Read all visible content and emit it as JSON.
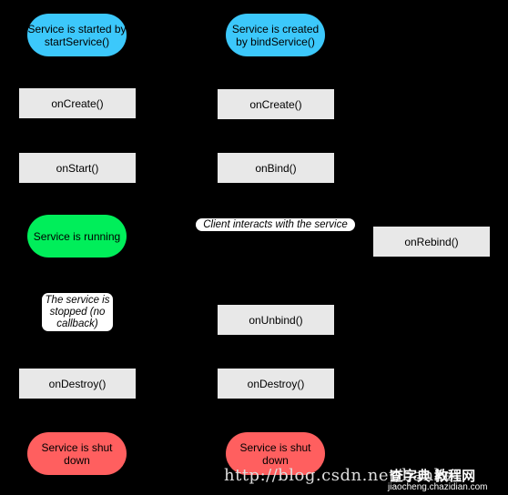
{
  "colors": {
    "start": "#3cc8fb",
    "running": "#00ee5a",
    "shutdown": "#ff5f5f",
    "box": "#e8e8e8"
  },
  "left": {
    "start": "Service is started by startService()",
    "on_create": "onCreate()",
    "on_start": "onStart()",
    "running": "Service is running",
    "stopped": "The service is stopped (no callback)",
    "on_destroy": "onDestroy()",
    "shutdown": "Service is shut down"
  },
  "right": {
    "start": "Service is created by bindService()",
    "on_create": "onCreate()",
    "on_bind": "onBind()",
    "client": "Client interacts with the service",
    "on_rebind": "onRebind()",
    "on_unbind": "onUnbind()",
    "on_destroy": "onDestroy()",
    "shutdown": "Service is shut down"
  },
  "watermark": {
    "url": "http://blog.csdn.net/banket",
    "brand": "查字典 教程网",
    "site": "jiaocheng.chazidian.com"
  }
}
